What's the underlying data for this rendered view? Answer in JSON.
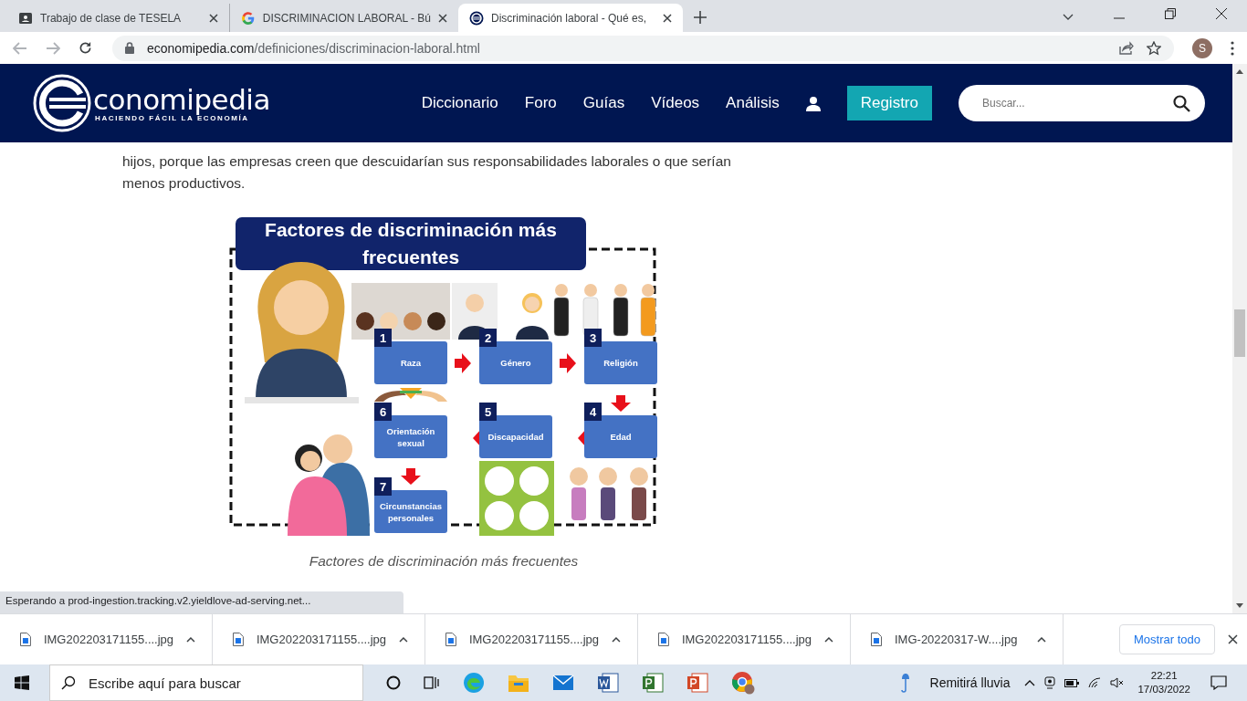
{
  "browser": {
    "tabs": [
      {
        "title": "Trabajo de clase de TESELA",
        "selected": false
      },
      {
        "title": "DISCRIMINACION LABORAL - Bú",
        "selected": false
      },
      {
        "title": "Discriminación laboral - Qué es,",
        "selected": true
      }
    ],
    "url": {
      "host": "economipedia.com",
      "path": "/definiciones/discriminacion-laboral.html"
    },
    "profile_initial": "S"
  },
  "site": {
    "logo": {
      "name": "conomipedia",
      "tagline": "HACIENDO FÁCIL LA ECONOMÍA"
    },
    "nav": [
      "Diccionario",
      "Foro",
      "Guías",
      "Vídeos",
      "Análisis"
    ],
    "register": "Registro",
    "search": {
      "placeholder": "Buscar..."
    }
  },
  "article": {
    "paragraph": "hijos, porque las empresas creen que descuidarían sus responsabilidades laborales o que serían menos productivos.",
    "figure": {
      "title": "Factores de discriminación más frecuentes",
      "steps": [
        {
          "number": "1",
          "label": "Raza"
        },
        {
          "number": "2",
          "label": "Género"
        },
        {
          "number": "3",
          "label": "Religión"
        },
        {
          "number": "6",
          "label": "Orientación sexual"
        },
        {
          "number": "5",
          "label": "Discapacidad"
        },
        {
          "number": "4",
          "label": "Edad"
        },
        {
          "number": "7",
          "label": "Circunstancias personales"
        }
      ],
      "caption": "Factores de discriminación más frecuentes"
    }
  },
  "status": "Esperando a prod-ingestion.tracking.v2.yieldlove-ad-serving.net...",
  "downloads": {
    "files": [
      "IMG202203171155....jpg",
      "IMG202203171155....jpg",
      "IMG202203171155....jpg",
      "IMG202203171155....jpg",
      "IMG-20220317-W....jpg"
    ],
    "show_all": "Mostrar todo"
  },
  "taskbar": {
    "search": {
      "placeholder": "Escribe aquí para buscar"
    },
    "weather": "Remitirá lluvia",
    "time": "22:21",
    "date": "17/03/2022"
  }
}
